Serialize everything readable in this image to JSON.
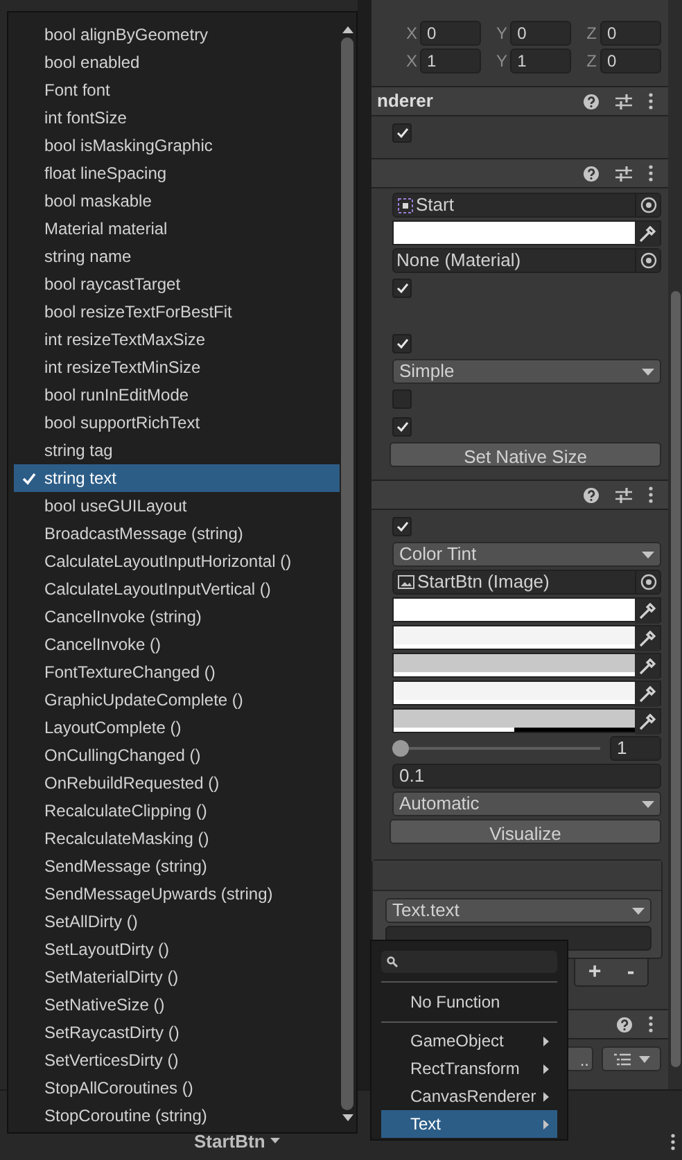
{
  "inspector": {
    "rows": [
      {
        "kind": "vector3",
        "fields": [
          {
            "axis": "X",
            "value": "0"
          },
          {
            "axis": "Y",
            "value": "0"
          },
          {
            "axis": "Z",
            "value": "0"
          }
        ]
      },
      {
        "kind": "vector3",
        "fields": [
          {
            "axis": "X",
            "value": "1"
          },
          {
            "axis": "Y",
            "value": "1"
          },
          {
            "axis": "Z",
            "value": "0"
          }
        ]
      },
      {
        "kind": "header",
        "title": "nderer"
      },
      {
        "kind": "checkbox",
        "checked": true
      },
      {
        "kind": "header"
      },
      {
        "kind": "asset_field",
        "value": "Start"
      },
      {
        "kind": "color_field",
        "color": "#ffffff",
        "level": 1
      },
      {
        "kind": "object_field",
        "value": "None (Material)"
      },
      {
        "kind": "checkbox",
        "checked": true
      },
      {
        "kind": "covered"
      },
      {
        "kind": "checkbox",
        "checked": true
      },
      {
        "kind": "dropdown",
        "value": "Simple"
      },
      {
        "kind": "checkbox",
        "checked": false
      },
      {
        "kind": "checkbox",
        "checked": true
      },
      {
        "kind": "button",
        "label": "Set Native Size"
      },
      {
        "kind": "header"
      },
      {
        "kind": "checkbox",
        "checked": true
      },
      {
        "kind": "dropdown",
        "value": "Color Tint"
      },
      {
        "kind": "image_field",
        "value": "StartBtn (Image)"
      },
      {
        "kind": "color_field",
        "color": "#ffffff",
        "level": 1
      },
      {
        "kind": "color_field",
        "color": "#f4f4f4",
        "level": 1
      },
      {
        "kind": "color_field",
        "color": "#c8c8c8",
        "level": 1
      },
      {
        "kind": "color_field",
        "color": "#f4f4f4",
        "level": 1
      },
      {
        "kind": "color_field",
        "color": "#c8c8c8",
        "level": 0.5
      },
      {
        "kind": "slider",
        "level": 0,
        "value": "1"
      },
      {
        "kind": "number_field",
        "value": "0.1"
      },
      {
        "kind": "dropdown",
        "value": "Automatic"
      },
      {
        "kind": "button",
        "label": "Visualize"
      },
      {
        "kind": "event_panel",
        "target": "Text.text",
        "add": "+",
        "remove": "-"
      },
      {
        "kind": "minor_header"
      },
      {
        "kind": "button_row",
        "button": ".."
      }
    ]
  },
  "bottom_bar": {
    "label": "StartBtn"
  },
  "method_menu": {
    "items": [
      {
        "label": "bool alignByGeometry",
        "selected": false
      },
      {
        "label": "bool enabled",
        "selected": false
      },
      {
        "label": "Font font",
        "selected": false
      },
      {
        "label": "int fontSize",
        "selected": false
      },
      {
        "label": "bool isMaskingGraphic",
        "selected": false
      },
      {
        "label": "float lineSpacing",
        "selected": false
      },
      {
        "label": "bool maskable",
        "selected": false
      },
      {
        "label": "Material material",
        "selected": false
      },
      {
        "label": "string name",
        "selected": false
      },
      {
        "label": "bool raycastTarget",
        "selected": false
      },
      {
        "label": "bool resizeTextForBestFit",
        "selected": false
      },
      {
        "label": "int resizeTextMaxSize",
        "selected": false
      },
      {
        "label": "int resizeTextMinSize",
        "selected": false
      },
      {
        "label": "bool runInEditMode",
        "selected": false
      },
      {
        "label": "bool supportRichText",
        "selected": false
      },
      {
        "label": "string tag",
        "selected": false
      },
      {
        "label": "string text",
        "selected": true
      },
      {
        "label": "bool useGUILayout",
        "selected": false
      },
      {
        "label": "BroadcastMessage (string)",
        "selected": false
      },
      {
        "label": "CalculateLayoutInputHorizontal ()",
        "selected": false
      },
      {
        "label": "CalculateLayoutInputVertical ()",
        "selected": false
      },
      {
        "label": "CancelInvoke (string)",
        "selected": false
      },
      {
        "label": "CancelInvoke ()",
        "selected": false
      },
      {
        "label": "FontTextureChanged ()",
        "selected": false
      },
      {
        "label": "GraphicUpdateComplete ()",
        "selected": false
      },
      {
        "label": "LayoutComplete ()",
        "selected": false
      },
      {
        "label": "OnCullingChanged ()",
        "selected": false
      },
      {
        "label": "OnRebuildRequested ()",
        "selected": false
      },
      {
        "label": "RecalculateClipping ()",
        "selected": false
      },
      {
        "label": "RecalculateMasking ()",
        "selected": false
      },
      {
        "label": "SendMessage (string)",
        "selected": false
      },
      {
        "label": "SendMessageUpwards (string)",
        "selected": false
      },
      {
        "label": "SetAllDirty ()",
        "selected": false
      },
      {
        "label": "SetLayoutDirty ()",
        "selected": false
      },
      {
        "label": "SetMaterialDirty ()",
        "selected": false
      },
      {
        "label": "SetNativeSize ()",
        "selected": false
      },
      {
        "label": "SetRaycastDirty ()",
        "selected": false
      },
      {
        "label": "SetVerticesDirty ()",
        "selected": false
      },
      {
        "label": "StopAllCoroutines ()",
        "selected": false
      },
      {
        "label": "StopCoroutine (string)",
        "selected": false
      }
    ]
  },
  "component_menu": {
    "items": [
      {
        "kind": "none",
        "label": "No Function",
        "selected": false
      },
      {
        "kind": "submenu",
        "label": "GameObject",
        "selected": false
      },
      {
        "kind": "submenu",
        "label": "RectTransform",
        "selected": false
      },
      {
        "kind": "submenu",
        "label": "CanvasRenderer",
        "selected": false
      },
      {
        "kind": "submenu",
        "label": "Text",
        "selected": true
      }
    ]
  }
}
